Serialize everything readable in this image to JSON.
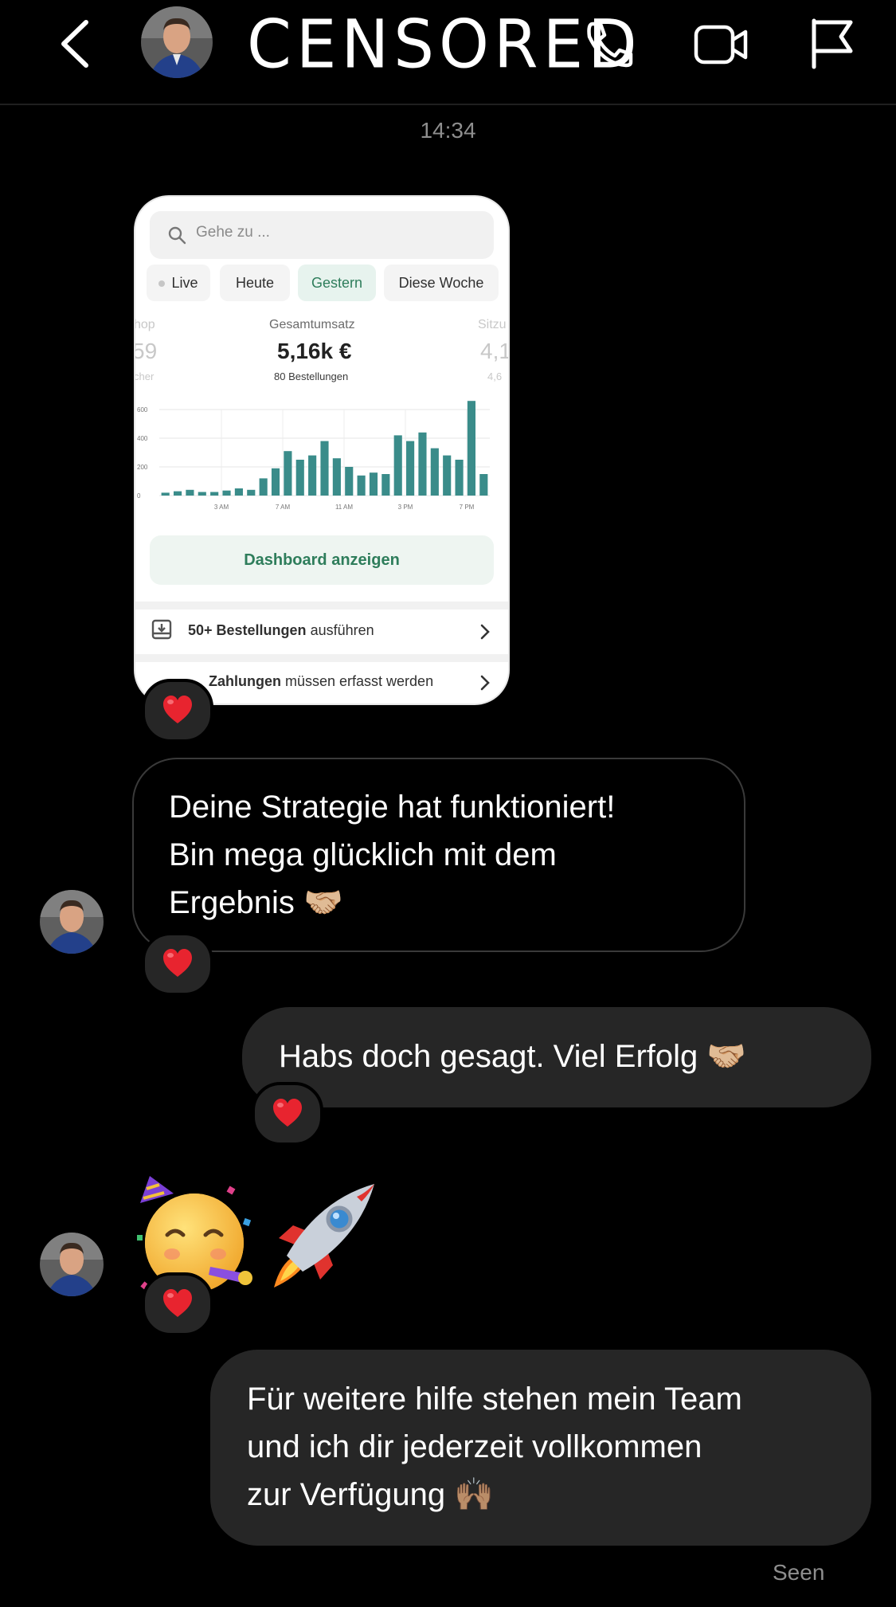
{
  "header": {
    "title": "CENSORED",
    "icons": [
      "back-arrow-icon",
      "profile-avatar",
      "phone-icon",
      "video-icon",
      "flag-icon"
    ]
  },
  "timestamp": "14:34",
  "shared_screenshot": {
    "search_placeholder": "Gehe zu ...",
    "tabs": [
      "Live",
      "Heute",
      "Gestern",
      "Diese Woche"
    ],
    "active_tab": "Gestern",
    "left_stat": {
      "label": "hop",
      "value": "59",
      "sub": "cher"
    },
    "center_stat": {
      "label": "Gesamtumsatz",
      "value": "5,16k €",
      "sub": "80 Bestellungen"
    },
    "right_stat": {
      "label": "Sitzu",
      "value": "4,1",
      "sub": "4,6"
    },
    "dashboard_button": "Dashboard anzeigen",
    "row1": {
      "bold": "50+ Bestellungen",
      "rest": " ausführen"
    },
    "row2": {
      "bold": "Zahlungen",
      "rest": " müssen erfasst werden"
    },
    "accent_color": "#2e7d5b",
    "bar_color": "#3a8c8a"
  },
  "chart_data": {
    "type": "bar",
    "x_tick_labels": [
      "3 AM",
      "7 AM",
      "11 AM",
      "3 PM",
      "7 PM"
    ],
    "y_tick_labels": [
      "0",
      "200",
      "400",
      "600"
    ],
    "ylim": [
      0,
      600
    ],
    "values": [
      20,
      30,
      40,
      25,
      25,
      35,
      50,
      40,
      120,
      190,
      310,
      250,
      280,
      380,
      260,
      200,
      140,
      160,
      150,
      420,
      380,
      440,
      330,
      280,
      250,
      660,
      150
    ]
  },
  "messages": [
    {
      "from": "them",
      "lines": [
        "Deine Strategie hat funktioniert!",
        "Bin mega glücklich mit dem",
        "Ergebnis 🤝🏼"
      ]
    },
    {
      "from": "me",
      "lines": [
        "Habs doch gesagt. Viel Erfolg 🤝🏼"
      ]
    },
    {
      "from": "them",
      "emoji": "🥳🚀"
    },
    {
      "from": "me",
      "lines": [
        "Für weitere hilfe stehen mein Team",
        "und ich dir jederzeit vollkommen",
        "zur Verfügung 🙌🏽"
      ]
    }
  ],
  "reaction": "heart",
  "colors": {
    "background": "#000000",
    "outgoing_bubble": "#262626",
    "incoming_border": "#3a3a3a",
    "heart": "#e8242f",
    "muted_text": "#8e8e8e"
  },
  "seen_label": "Seen"
}
